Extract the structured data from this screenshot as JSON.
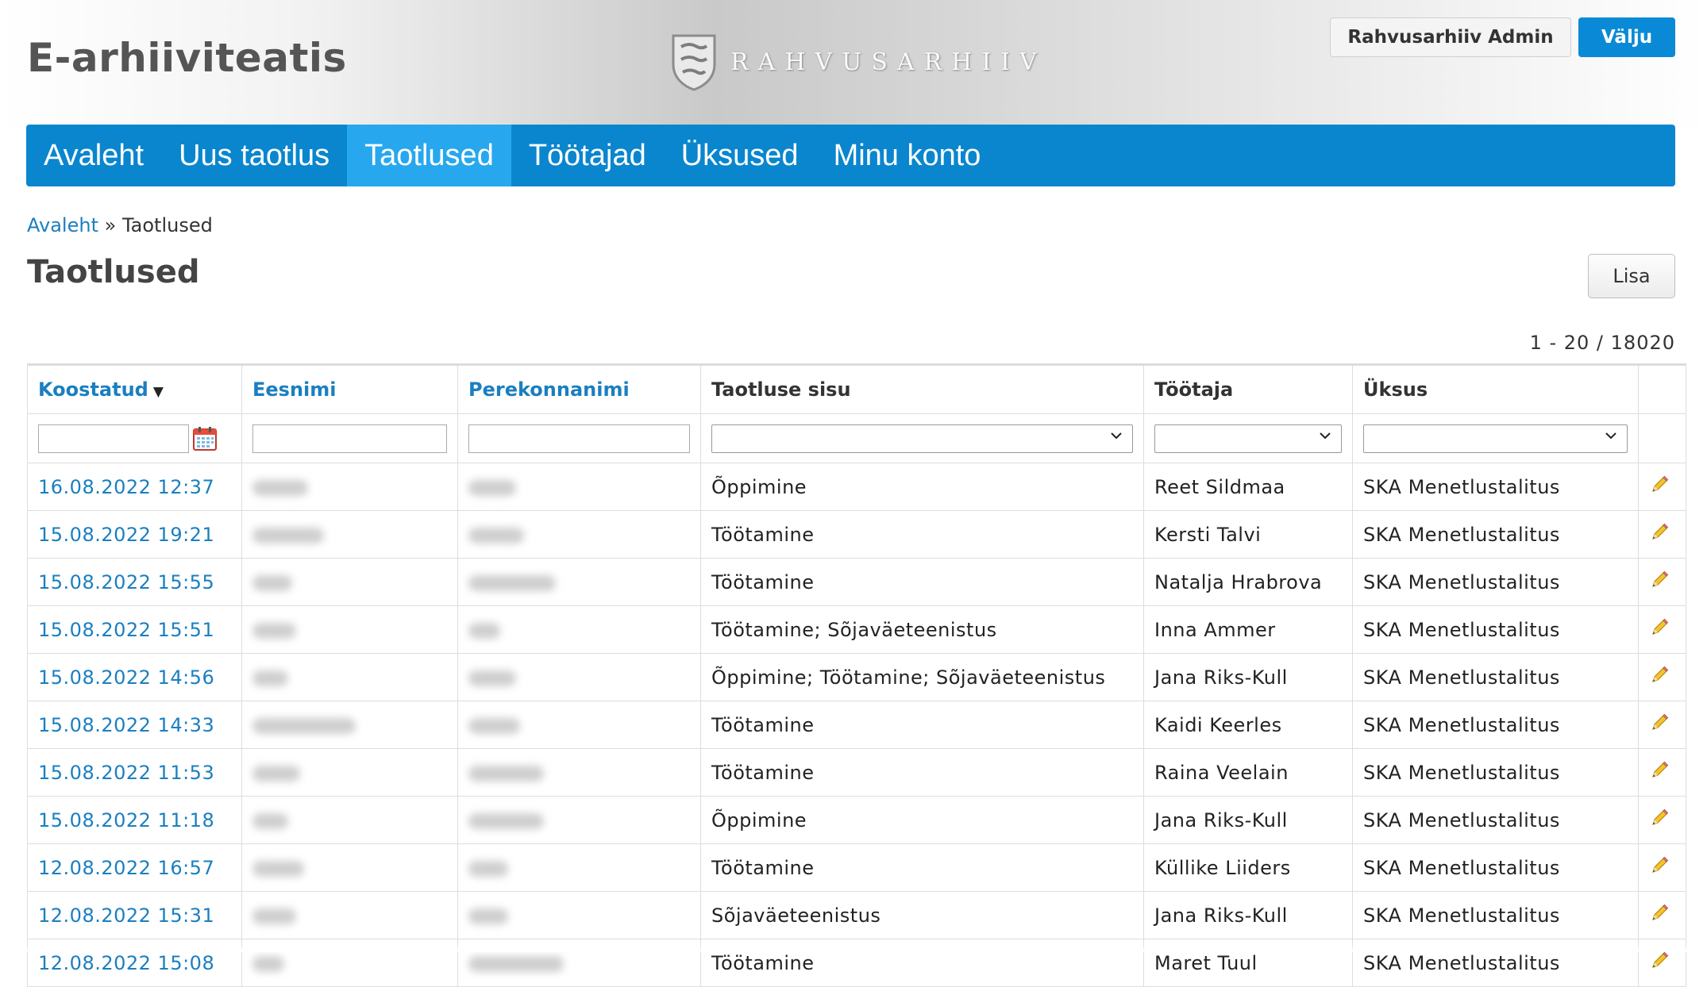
{
  "header": {
    "app_title": "E-arhiiviteatis",
    "logo_text": "RAHVUSARHIIV",
    "user_button": "Rahvusarhiiv Admin",
    "logout_button": "Välju"
  },
  "nav": {
    "items": [
      {
        "label": "Avaleht",
        "active": false
      },
      {
        "label": "Uus taotlus",
        "active": false
      },
      {
        "label": "Taotlused",
        "active": true
      },
      {
        "label": "Töötajad",
        "active": false
      },
      {
        "label": "Üksused",
        "active": false
      },
      {
        "label": "Minu konto",
        "active": false
      }
    ]
  },
  "breadcrumb": {
    "home": "Avaleht",
    "separator": "»",
    "current": "Taotlused"
  },
  "page": {
    "title": "Taotlused",
    "add_button": "Lisa",
    "pager": "1 - 20 / 18020"
  },
  "table": {
    "columns": {
      "created": "Koostatud",
      "first_name": "Eesnimi",
      "last_name": "Perekonnanimi",
      "content": "Taotluse sisu",
      "employee": "Töötaja",
      "unit": "Üksus"
    },
    "rows": [
      {
        "date": "16.08.2022 12:37",
        "content": "Õppimine",
        "employee": "Reet Sildmaa",
        "unit": "SKA Menetlustalitus"
      },
      {
        "date": "15.08.2022 19:21",
        "content": "Töötamine",
        "employee": "Kersti Talvi",
        "unit": "SKA Menetlustalitus"
      },
      {
        "date": "15.08.2022 15:55",
        "content": "Töötamine",
        "employee": "Natalja Hrabrova",
        "unit": "SKA Menetlustalitus"
      },
      {
        "date": "15.08.2022 15:51",
        "content": "Töötamine; Sõjaväeteenistus",
        "employee": "Inna Ammer",
        "unit": "SKA Menetlustalitus"
      },
      {
        "date": "15.08.2022 14:56",
        "content": "Õppimine; Töötamine; Sõjaväeteenistus",
        "employee": "Jana Riks-Kull",
        "unit": "SKA Menetlustalitus"
      },
      {
        "date": "15.08.2022 14:33",
        "content": "Töötamine",
        "employee": "Kaidi Keerles",
        "unit": "SKA Menetlustalitus"
      },
      {
        "date": "15.08.2022 11:53",
        "content": "Töötamine",
        "employee": "Raina Veelain",
        "unit": "SKA Menetlustalitus"
      },
      {
        "date": "15.08.2022 11:18",
        "content": "Õppimine",
        "employee": "Jana Riks-Kull",
        "unit": "SKA Menetlustalitus"
      },
      {
        "date": "12.08.2022 16:57",
        "content": "Töötamine",
        "employee": "Küllike Liiders",
        "unit": "SKA Menetlustalitus"
      },
      {
        "date": "12.08.2022 15:31",
        "content": "Sõjaväeteenistus",
        "employee": "Jana Riks-Kull",
        "unit": "SKA Menetlustalitus"
      },
      {
        "date": "12.08.2022 15:08",
        "content": "Töötamine",
        "employee": "Maret Tuul",
        "unit": "SKA Menetlustalitus"
      }
    ]
  },
  "icons": {
    "edit": "pencil-icon",
    "calendar": "calendar-icon",
    "dropdown": "chevron-down-icon",
    "sort": "sort-desc-icon"
  },
  "colors": {
    "nav_bg": "#0a86cf",
    "nav_active": "#27a8ee",
    "link": "#1a7fc0",
    "logout_bg": "#0a8ad6"
  }
}
